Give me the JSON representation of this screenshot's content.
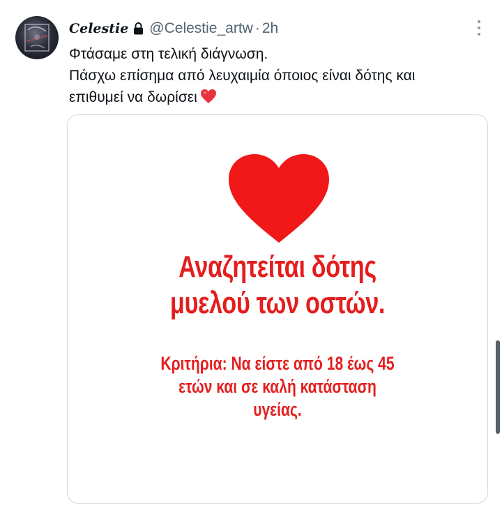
{
  "tweet": {
    "display_name": "Celestie",
    "handle": "@Celestie_artw",
    "separator": "·",
    "time": "2h",
    "text_lines": [
      "Φτάσαμε στη τελική διάγνωση.",
      "Πάσχω επίσημα από λευχαιμία όποιος είναι δότης και",
      "επιθυμεί να δωρίσει"
    ]
  },
  "media": {
    "headline_lines": [
      "Αναζητείται δότης",
      "μυελού των οστών."
    ],
    "criteria_lines": [
      "Κριτήρια: Να είστε από 18 έως 45",
      "ετών και σε καλή κατάσταση",
      "υγείας."
    ]
  },
  "colors": {
    "accent_red": "#e41e1e",
    "text_primary": "#0f1419",
    "text_secondary": "#536471",
    "card_border": "#cfd9de"
  },
  "icons": {
    "lock": "lock-icon",
    "more": "more-icon",
    "heart_emoji": "red-heart-emoji-icon",
    "big_heart": "big-heart-icon"
  }
}
